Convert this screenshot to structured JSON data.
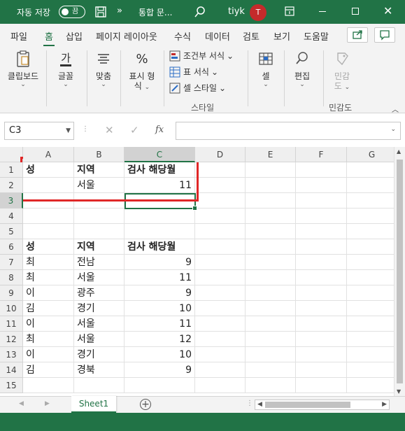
{
  "titlebar": {
    "autosave_label": "자동 저장",
    "toggle_text": "끔",
    "more": "»",
    "doc_title": "통합 문...",
    "user_name": "tiyk",
    "avatar_initial": "T"
  },
  "tabs": [
    "파일",
    "홈",
    "삽입",
    "페이지 레이아웃",
    "수식",
    "데이터",
    "검토",
    "보기",
    "도움말"
  ],
  "ribbon": {
    "clipboard": "클립보드",
    "font": "글꼴",
    "align": "맞춤",
    "number_l1": "표시 형",
    "number_l2": "식",
    "cond_format": "조건부 서식",
    "table_format": "표 서식",
    "cell_style": "셀 스타일",
    "styles_group": "스타일",
    "cells": "셀",
    "editing": "편집",
    "sensitivity_l1": "민감",
    "sensitivity_l2": "도",
    "sensitivity_group": "민감도"
  },
  "formula_bar": {
    "name_box": "C3",
    "fx": "fx",
    "formula": ""
  },
  "grid": {
    "columns": [
      "A",
      "B",
      "C",
      "D",
      "E",
      "F",
      "G"
    ],
    "rows": [
      "1",
      "2",
      "3",
      "4",
      "5",
      "6",
      "7",
      "8",
      "9",
      "10",
      "11",
      "12",
      "13",
      "14",
      "15"
    ],
    "cells": [
      [
        "성",
        "지역",
        "검사 해당월"
      ],
      [
        "",
        "서울",
        "11"
      ],
      [
        "",
        "",
        ""
      ],
      [
        "",
        "",
        ""
      ],
      [
        "",
        "",
        ""
      ],
      [
        "성",
        "지역",
        "검사 해당월"
      ],
      [
        "최",
        "전남",
        "9"
      ],
      [
        "최",
        "서울",
        "11"
      ],
      [
        "이",
        "광주",
        "9"
      ],
      [
        "김",
        "경기",
        "10"
      ],
      [
        "이",
        "서울",
        "11"
      ],
      [
        "최",
        "서울",
        "12"
      ],
      [
        "이",
        "경기",
        "10"
      ],
      [
        "김",
        "경북",
        "9"
      ],
      [
        "",
        "",
        ""
      ]
    ]
  },
  "sheets": {
    "active": "Sheet1"
  },
  "colors": {
    "accent": "#217346",
    "highlight_box": "#e02727"
  }
}
